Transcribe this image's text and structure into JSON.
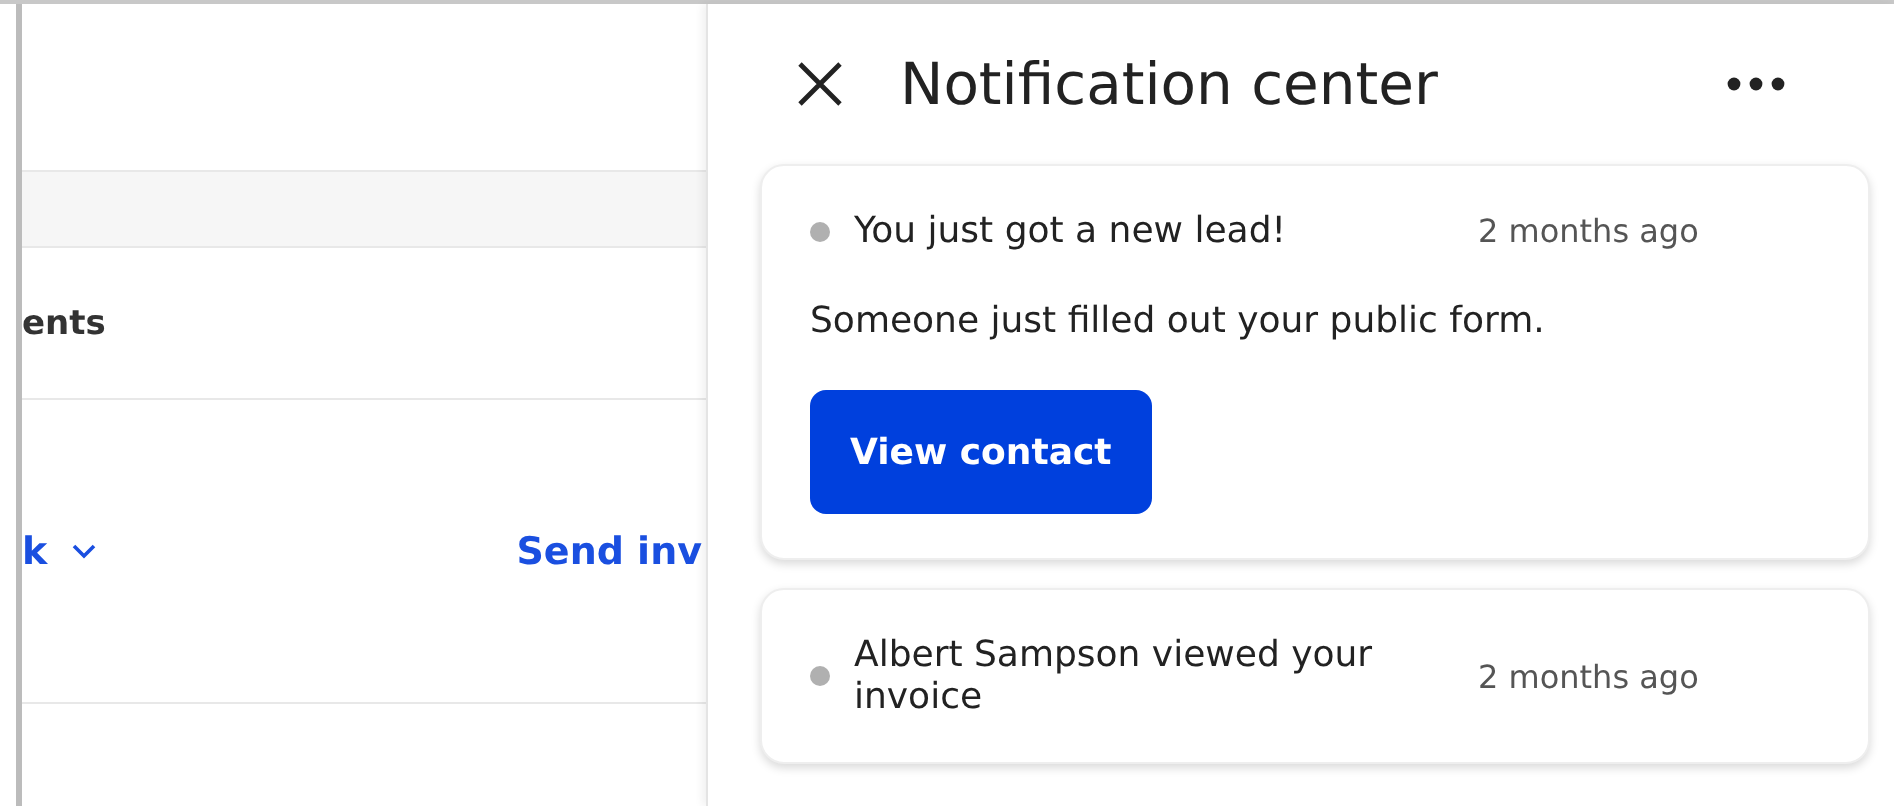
{
  "background": {
    "section_label": "ents",
    "dropdown_label": "k",
    "send_link": "Send inv"
  },
  "notification_center": {
    "title": "Notification center",
    "notifications": [
      {
        "title": "You just got a new lead!",
        "time": "2 months ago",
        "body": "Someone just filled out your public form.",
        "action": "View contact"
      },
      {
        "title": "Albert Sampson viewed your invoice",
        "time": "2 months ago"
      }
    ]
  }
}
